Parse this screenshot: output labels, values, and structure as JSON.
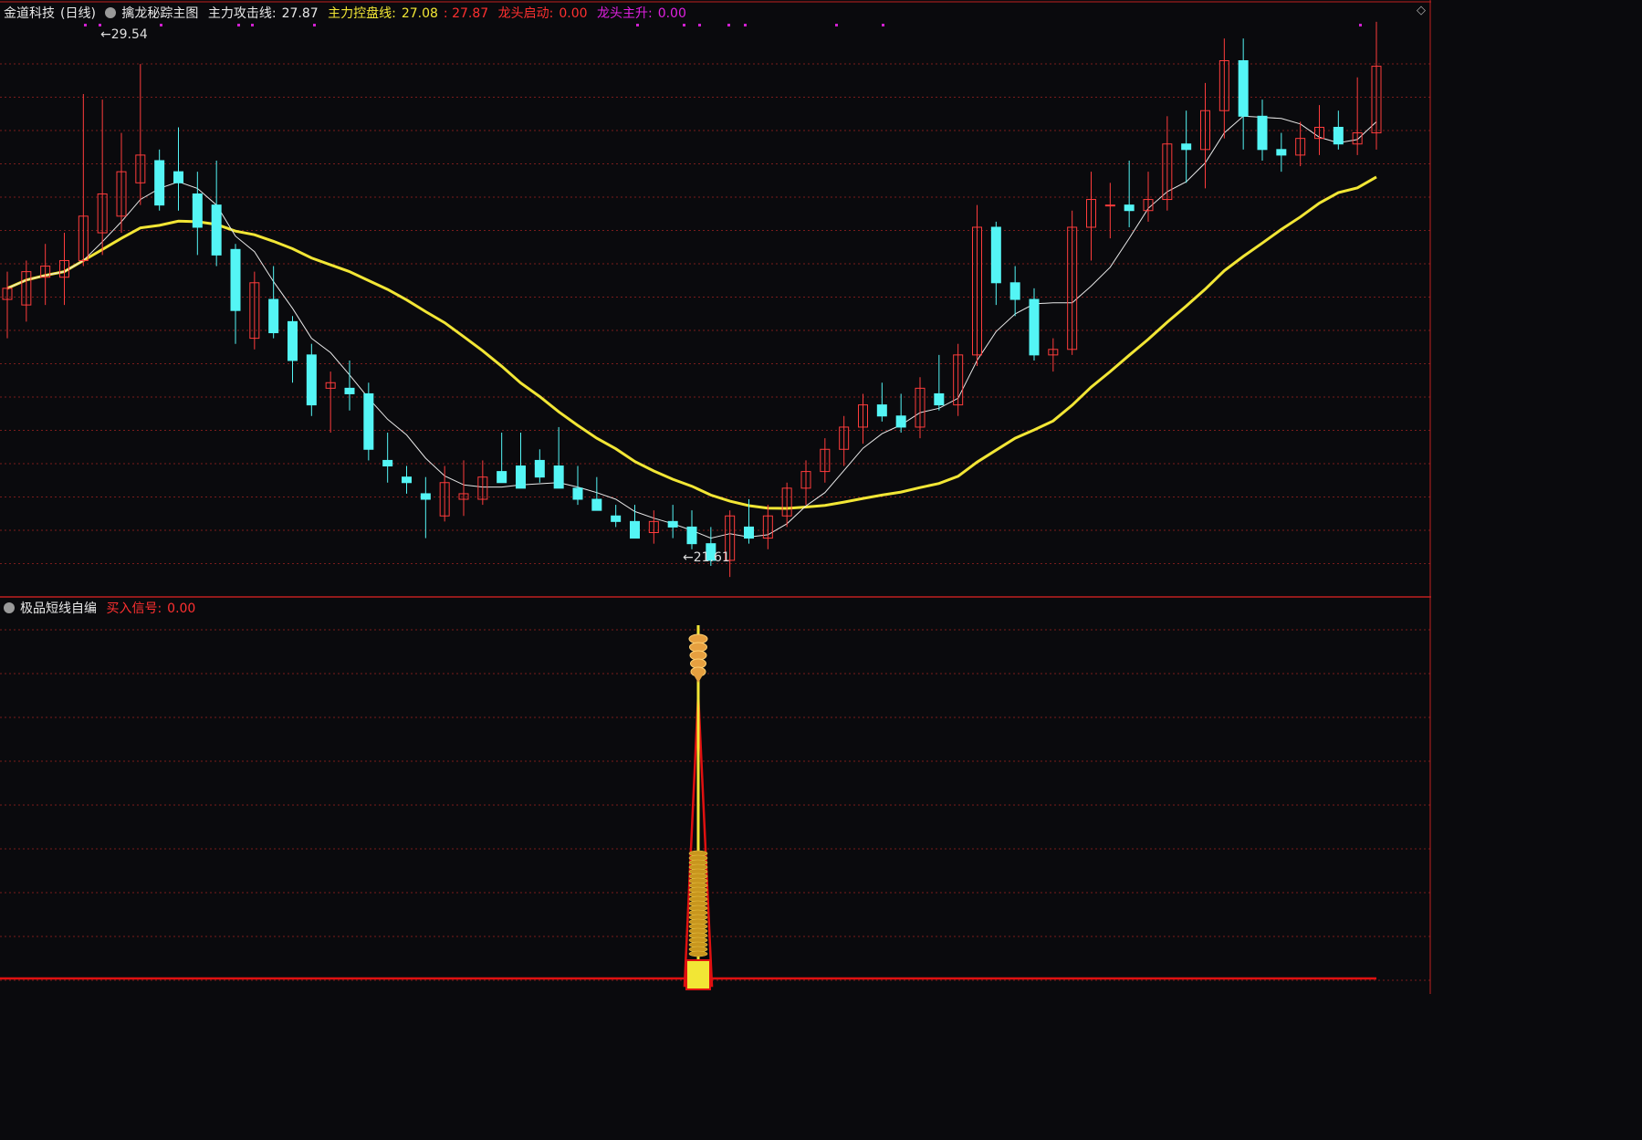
{
  "colors": {
    "background": "#0a0a0d",
    "up": "#ff3c3c",
    "down": "#54f5f5",
    "ma_short": "#e8e8e8",
    "ma_red": "#e02020",
    "ma_yellow": "#f2e635",
    "grid": "#7a1c1c",
    "divider": "#c02020",
    "dots": "#d020d0"
  },
  "header": {
    "stock": "金道科技",
    "period": "(日线)",
    "indicator_name": "擒龙秘踪主图",
    "attack_label": "主力攻击线:",
    "attack_value": "27.87",
    "control_label": "主力控盘线:",
    "control_value": "27.08",
    "extra_value": ": 27.87",
    "start_label": "龙头启动:",
    "start_value": "0.00",
    "rise_label": "龙头主升:",
    "rise_value": "0.00"
  },
  "sub_header": {
    "indicator_name": "极品短线自编",
    "signal_label": "买入信号:",
    "signal_value": "0.00"
  },
  "top_right_icon": "diamond-icon",
  "chart_data": [
    {
      "type": "candlestick",
      "high_annotation": "29.54",
      "low_annotation": "21.61",
      "ylim": [
        20.5,
        30.2
      ],
      "candles": [
        [
          25.3,
          25.8,
          24.6,
          25.5
        ],
        [
          25.2,
          26.0,
          24.9,
          25.8
        ],
        [
          25.7,
          26.3,
          25.2,
          25.9
        ],
        [
          25.7,
          26.5,
          25.2,
          26.0
        ],
        [
          26.0,
          29.0,
          25.9,
          26.8
        ],
        [
          26.5,
          28.9,
          26.1,
          27.2
        ],
        [
          26.8,
          28.3,
          26.5,
          27.6
        ],
        [
          27.4,
          29.54,
          27.0,
          27.9
        ],
        [
          27.8,
          28.0,
          26.9,
          27.0
        ],
        [
          27.6,
          28.4,
          26.9,
          27.4
        ],
        [
          27.2,
          27.6,
          26.1,
          26.6
        ],
        [
          27.0,
          27.8,
          25.9,
          26.1
        ],
        [
          26.2,
          26.3,
          24.5,
          25.1
        ],
        [
          24.6,
          25.8,
          24.4,
          25.6
        ],
        [
          25.3,
          25.9,
          24.6,
          24.7
        ],
        [
          24.9,
          25.0,
          23.8,
          24.2
        ],
        [
          24.3,
          24.5,
          23.2,
          23.4
        ],
        [
          23.7,
          24.0,
          22.9,
          23.8
        ],
        [
          23.7,
          24.2,
          23.3,
          23.6
        ],
        [
          23.6,
          23.8,
          22.4,
          22.6
        ],
        [
          22.4,
          22.9,
          22.0,
          22.3
        ],
        [
          22.1,
          22.3,
          21.8,
          22.0
        ],
        [
          21.8,
          22.1,
          21.0,
          21.7
        ],
        [
          21.4,
          22.3,
          21.3,
          22.0
        ],
        [
          21.7,
          22.4,
          21.4,
          21.8
        ],
        [
          21.7,
          22.4,
          21.6,
          22.1
        ],
        [
          22.2,
          22.9,
          22.0,
          22.0
        ],
        [
          22.3,
          22.9,
          21.9,
          21.9
        ],
        [
          22.4,
          22.6,
          22.0,
          22.1
        ],
        [
          22.3,
          23.0,
          22.1,
          21.9
        ],
        [
          21.9,
          22.3,
          21.6,
          21.7
        ],
        [
          21.7,
          22.1,
          21.5,
          21.5
        ],
        [
          21.4,
          21.6,
          21.2,
          21.3
        ],
        [
          21.3,
          21.6,
          21.0,
          21.0
        ],
        [
          21.1,
          21.5,
          20.9,
          21.3
        ],
        [
          21.3,
          21.6,
          21.0,
          21.2
        ],
        [
          21.2,
          21.5,
          20.8,
          20.9
        ],
        [
          20.9,
          21.2,
          20.5,
          20.6
        ],
        [
          20.6,
          21.5,
          20.3,
          21.4
        ],
        [
          21.2,
          21.7,
          20.9,
          21.0
        ]
      ]
    },
    {
      "type": "line",
      "title": "极品短线自编",
      "series": [
        {
          "name": "买入信号",
          "values": [
            0,
            0,
            0,
            0,
            1,
            0,
            0
          ]
        }
      ],
      "categories": [
        "",
        "",
        "",
        "",
        "",
        "",
        ""
      ]
    }
  ]
}
